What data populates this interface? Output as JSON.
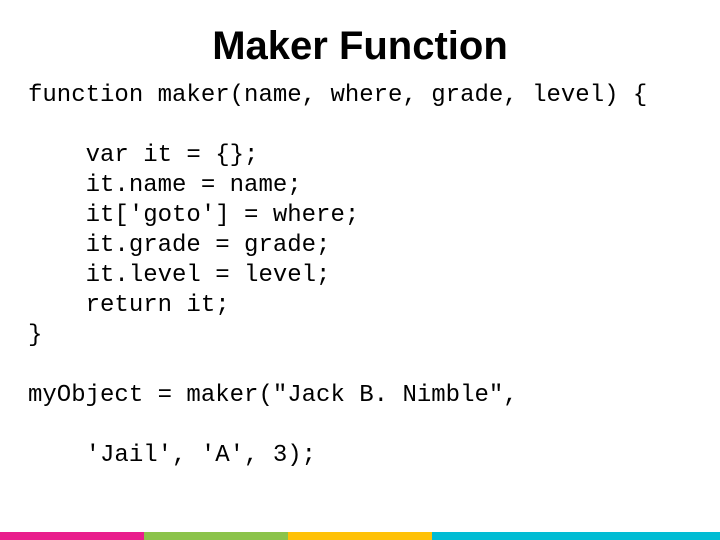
{
  "title": "Maker Function",
  "code": "function maker(name, where, grade, level) {\n\n    var it = {};\n    it.name = name;\n    it['goto'] = where;\n    it.grade = grade;\n    it.level = level;\n    return it;\n}\n\nmyObject = maker(\"Jack B. Nimble\",\n\n    'Jail', 'A', 3);",
  "footer_colors": [
    "#e91e8c",
    "#8bc34a",
    "#ffc107",
    "#00bcd4"
  ]
}
